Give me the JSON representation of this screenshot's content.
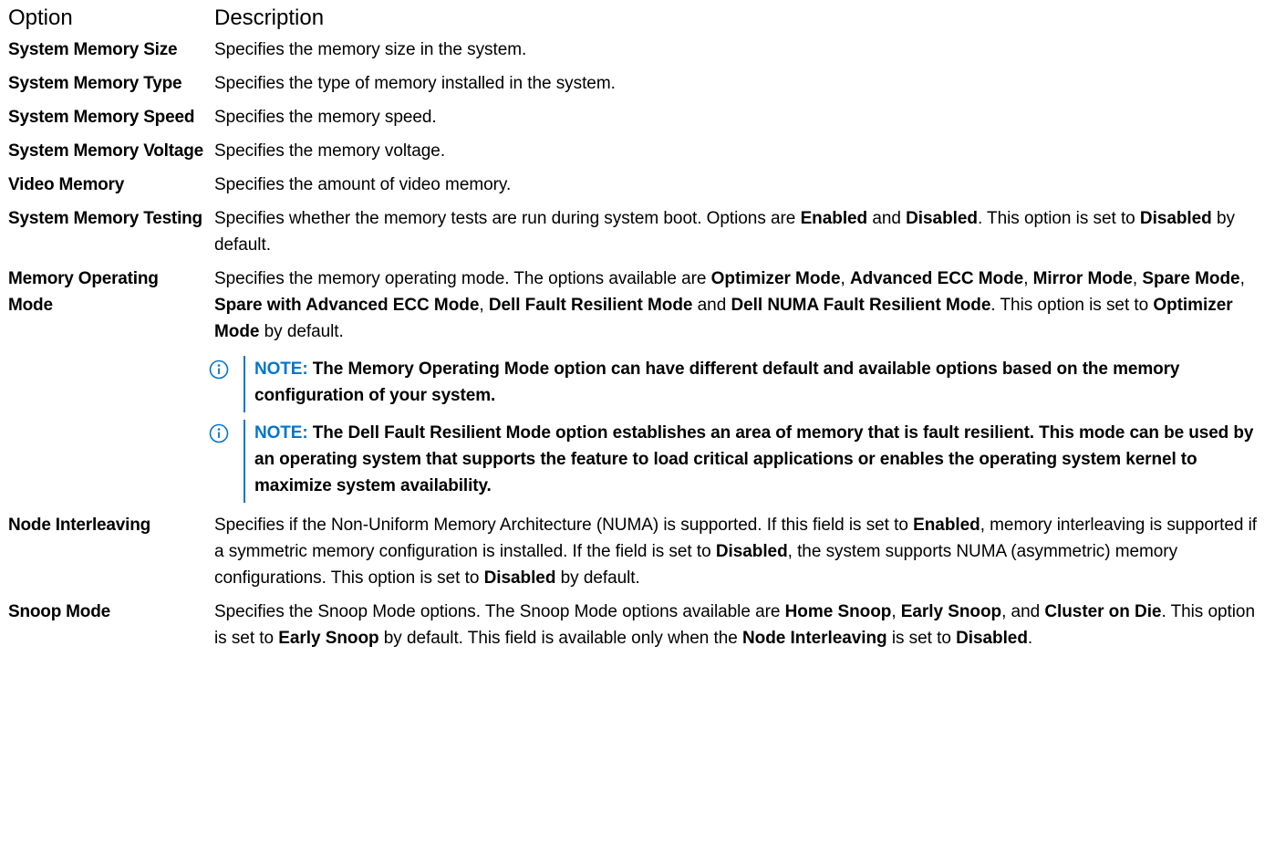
{
  "header": {
    "option": "Option",
    "description": "Description"
  },
  "rows": [
    {
      "name": "System Memory Size",
      "desc": "Specifies the memory size in the system."
    },
    {
      "name": "System Memory Type",
      "desc": "Specifies the type of memory installed in the system."
    },
    {
      "name": "System Memory Speed",
      "desc": "Specifies the memory speed."
    },
    {
      "name": "System Memory Voltage",
      "desc": "Specifies the memory voltage."
    },
    {
      "name": "Video Memory",
      "desc": "Specifies the amount of video memory."
    },
    {
      "name": "System Memory Testing",
      "desc_parts": [
        {
          "t": "Specifies whether the memory tests are run during system boot. Options are "
        },
        {
          "t": "Enabled",
          "b": true
        },
        {
          "t": " and "
        },
        {
          "t": "Disabled",
          "b": true
        },
        {
          "t": ". This option is set to "
        },
        {
          "t": "Disabled",
          "b": true
        },
        {
          "t": " by default."
        }
      ]
    },
    {
      "name": "Memory Operating Mode",
      "desc_parts": [
        {
          "t": "Specifies the memory operating mode. The options available are "
        },
        {
          "t": "Optimizer Mode",
          "b": true
        },
        {
          "t": ", "
        },
        {
          "t": "Advanced ECC Mode",
          "b": true
        },
        {
          "t": ", "
        },
        {
          "t": "Mirror Mode",
          "b": true
        },
        {
          "t": ", "
        },
        {
          "t": "Spare Mode",
          "b": true
        },
        {
          "t": ", "
        },
        {
          "t": "Spare with Advanced ECC Mode",
          "b": true
        },
        {
          "t": ", "
        },
        {
          "t": "Dell Fault Resilient Mode",
          "b": true
        },
        {
          "t": " and "
        },
        {
          "t": "Dell NUMA Fault Resilient Mode",
          "b": true
        },
        {
          "t": ". This option is set to "
        },
        {
          "t": "Optimizer Mode",
          "b": true
        },
        {
          "t": " by default."
        }
      ],
      "notes": [
        {
          "label": "NOTE:",
          "text": "The Memory Operating Mode option can have different default and available options based on the memory configuration of your system."
        },
        {
          "label": "NOTE:",
          "text": "The Dell Fault Resilient Mode option establishes an area of memory that is fault resilient. This mode can be used by an operating system that supports the feature to load critical applications or enables the operating system kernel to maximize system availability."
        }
      ]
    },
    {
      "name": "Node Interleaving",
      "desc_parts": [
        {
          "t": "Specifies if the Non-Uniform Memory Architecture (NUMA) is supported. If this field is set to "
        },
        {
          "t": "Enabled",
          "b": true
        },
        {
          "t": ", memory interleaving is supported if a symmetric memory configuration is installed. If the field is set to "
        },
        {
          "t": "Disabled",
          "b": true
        },
        {
          "t": ", the system supports NUMA (asymmetric) memory configurations. This option is set to "
        },
        {
          "t": "Disabled",
          "b": true
        },
        {
          "t": " by default."
        }
      ]
    },
    {
      "name": "Snoop Mode",
      "desc_parts": [
        {
          "t": "Specifies the Snoop Mode options. The Snoop Mode options available are "
        },
        {
          "t": "Home Snoop",
          "b": true
        },
        {
          "t": ", "
        },
        {
          "t": "Early Snoop",
          "b": true
        },
        {
          "t": ", and "
        },
        {
          "t": "Cluster on Die",
          "b": true
        },
        {
          "t": ". This option is set to "
        },
        {
          "t": "Early Snoop",
          "b": true
        },
        {
          "t": " by default. This field is available only when the "
        },
        {
          "t": "Node Interleaving",
          "b": true
        },
        {
          "t": " is set to "
        },
        {
          "t": "Disabled",
          "b": true
        },
        {
          "t": "."
        }
      ]
    }
  ],
  "colors": {
    "note_accent": "#0076ce",
    "text": "#000000"
  },
  "icons": {
    "note": "info-circle-icon"
  }
}
